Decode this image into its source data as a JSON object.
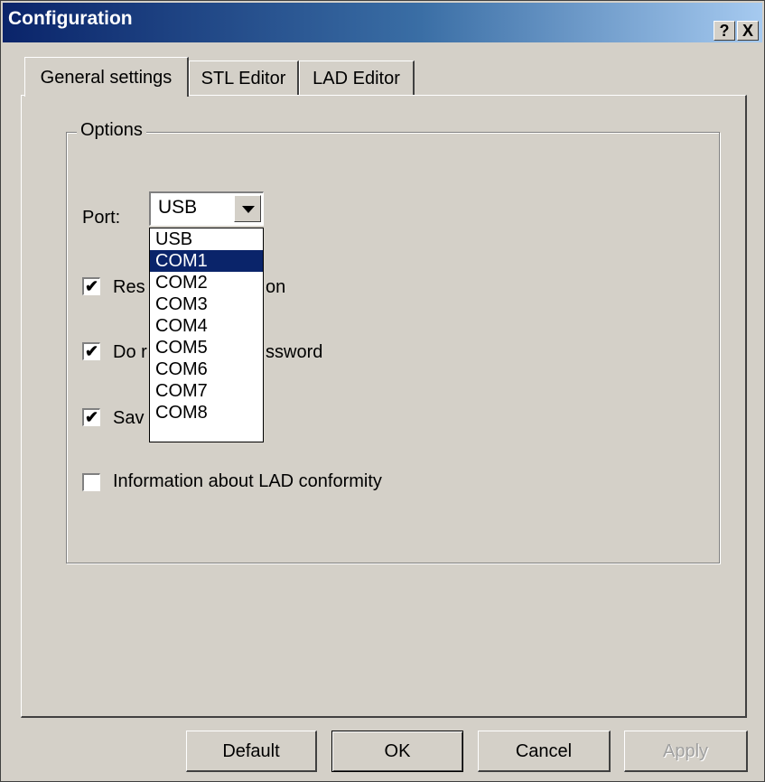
{
  "window": {
    "title": "Configuration",
    "help_label": "?",
    "close_label": "X"
  },
  "tabs": [
    {
      "label": "General settings",
      "active": true
    },
    {
      "label": "STL Editor",
      "active": false
    },
    {
      "label": "LAD Editor",
      "active": false
    }
  ],
  "options_group": {
    "label": "Options",
    "port_label": "Port:",
    "port_value": "USB",
    "checkboxes": [
      {
        "label_prefix": "Res",
        "label_suffix": "on",
        "checked": true
      },
      {
        "label_prefix": "Do r",
        "label_suffix": "ssword",
        "checked": true
      },
      {
        "label_prefix": "Sav",
        "label_suffix": "",
        "checked": true
      },
      {
        "label": "Information about LAD conformity",
        "checked": false
      }
    ]
  },
  "port_dropdown": {
    "options": [
      "USB",
      "COM1",
      "COM2",
      "COM3",
      "COM4",
      "COM5",
      "COM6",
      "COM7",
      "COM8"
    ],
    "highlighted": "COM1"
  },
  "buttons": {
    "default": "Default",
    "ok": "OK",
    "cancel": "Cancel",
    "apply": "Apply"
  },
  "colors": {
    "titlebar_start": "#0a246a",
    "titlebar_end": "#a6caf0",
    "face": "#d4d0c8",
    "selection": "#0a246a"
  }
}
